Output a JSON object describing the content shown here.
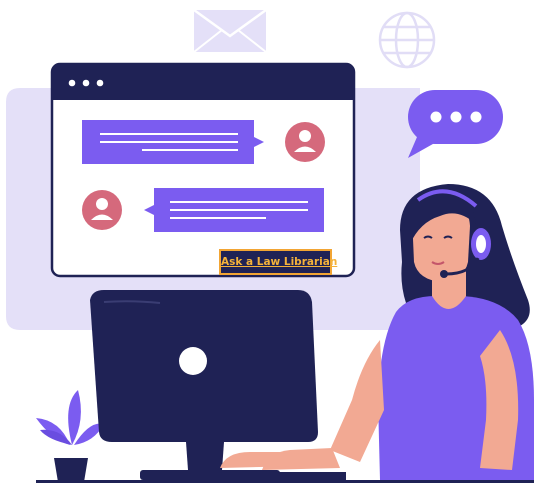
{
  "cta": {
    "label": "Ask a Law Librarian"
  },
  "colors": {
    "navy": "#1f2255",
    "purple": "#7b5cf0",
    "lavender": "#e4e0f8",
    "pink": "#d5697c",
    "skin": "#f2a993",
    "hair": "#1f2255",
    "orange_border": "#f2a534",
    "link_text": "#f4b23a"
  },
  "icons": [
    "envelope-icon",
    "globe-icon",
    "speech-bubble-icon",
    "user-avatar-icon",
    "headset-icon",
    "monitor-icon",
    "plant-icon"
  ]
}
